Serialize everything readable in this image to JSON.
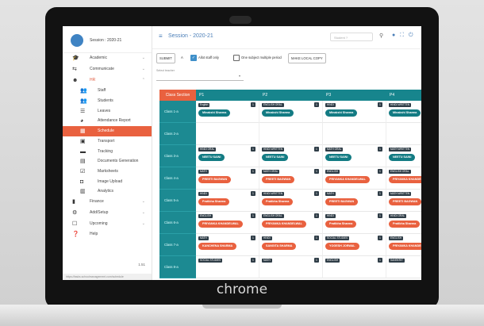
{
  "device": {
    "brand": "chrome"
  },
  "sidebar": {
    "session_label": "Session : 2020-21",
    "version": "1.51",
    "status_url": "https://tasks.schoolmanagement.com/schedule",
    "items": [
      {
        "label": "Academic",
        "icon": "graduation-cap-icon",
        "glyph": "🎓",
        "chevron": "⌄"
      },
      {
        "label": "Communicate",
        "icon": "chat-icon",
        "glyph": "⇆",
        "chevron": "⌄"
      },
      {
        "label": "HR",
        "icon": "hr-icon",
        "glyph": "☻",
        "chevron": "⌃"
      },
      {
        "label": "Staff",
        "icon": "staff-icon",
        "glyph": "👥",
        "sub": true
      },
      {
        "label": "Students",
        "icon": "students-icon",
        "glyph": "👥",
        "sub": true
      },
      {
        "label": "Leaves",
        "icon": "leaves-icon",
        "glyph": "☰",
        "sub": true
      },
      {
        "label": "Attendance Report",
        "icon": "attendance-icon",
        "glyph": "◕",
        "sub": true
      },
      {
        "label": "Schedule",
        "icon": "calendar-icon",
        "glyph": "▦",
        "sub": true,
        "active": true
      },
      {
        "label": "Transport",
        "icon": "bus-icon",
        "glyph": "▣",
        "sub": true
      },
      {
        "label": "Tracking",
        "icon": "truck-icon",
        "glyph": "▬",
        "sub": true
      },
      {
        "label": "Documents Generation",
        "icon": "document-icon",
        "glyph": "▤",
        "sub": true
      },
      {
        "label": "Marksheets",
        "icon": "marksheet-icon",
        "glyph": "☑",
        "sub": true
      },
      {
        "label": "Image Upload",
        "icon": "image-icon",
        "glyph": "◘",
        "sub": true
      },
      {
        "label": "Analytics",
        "icon": "analytics-icon",
        "glyph": "▥",
        "sub": true
      },
      {
        "label": "Finance",
        "icon": "finance-icon",
        "glyph": "▮",
        "chevron": "⌄"
      },
      {
        "label": "Add/Setup",
        "icon": "gear-icon",
        "glyph": "⚙",
        "chevron": "⌄"
      },
      {
        "label": "Upcoming",
        "icon": "upcoming-icon",
        "glyph": "☐",
        "chevron": "⌄"
      },
      {
        "label": "Help",
        "icon": "help-icon",
        "glyph": "❓"
      }
    ]
  },
  "topbar": {
    "menu_glyph": "≡",
    "title": "Session - 2020-21",
    "search_placeholder": "Student ?",
    "search_glyph": "⚲",
    "icons_glyph": "● ⛶ ⏻"
  },
  "toolbar": {
    "submit": "SUBMIT",
    "font_button": "A",
    "check_mark": "✓",
    "staff_only": "Allot staff only",
    "multiple_period": "One subject multiple period",
    "make_copy": "MAKE LOCAL COPY"
  },
  "filter": {
    "label": "Select teacher",
    "chevron": "▾"
  },
  "accent_colors": {
    "header": "#17858d",
    "active": "#e9613f",
    "teal_pill": "#137b83"
  },
  "schedule": {
    "corner": "Class Section",
    "periods": [
      "P1",
      "P2",
      "P3",
      "P4"
    ],
    "rows": [
      {
        "class": "Class 1-a",
        "cells": [
          {
            "subject": "English",
            "num": "1",
            "teacher": "Minakshi Sharma",
            "color": "teal"
          },
          {
            "subject": "ENGLISH ORAL",
            "num": "1",
            "teacher": "Minakshi Sharma",
            "color": "teal"
          },
          {
            "subject": "HINDI",
            "num": "1",
            "teacher": "Minakshi Sharma",
            "color": "teal"
          },
          {
            "subject": "HINDI WRITTEN",
            "num": "1",
            "teacher": "Minakshi Sharma",
            "color": "teal"
          }
        ]
      },
      {
        "class": "Class 2-a",
        "cells": [
          {},
          {},
          {},
          {}
        ]
      },
      {
        "class": "Class 3-a",
        "cells": [
          {
            "subject": "HINDI ORAL",
            "num": "1",
            "teacher": "NEETU SAINI",
            "color": "teal"
          },
          {
            "subject": "HINDI WRITTEN",
            "num": "1",
            "teacher": "NEETU SAINI",
            "color": "teal"
          },
          {
            "subject": "MATH ORAL",
            "num": "1",
            "teacher": "NEETU SAINI",
            "color": "teal"
          },
          {
            "subject": "MATH WRITTEN",
            "num": "1",
            "teacher": "NEETU SAINI",
            "color": "teal"
          }
        ]
      },
      {
        "class": "Class 4-a",
        "cells": [
          {
            "subject": "MATH",
            "num": "1",
            "teacher": "PREETI BAGWAN",
            "color": "orange"
          },
          {
            "subject": "MATH ORAL",
            "num": "1",
            "teacher": "PREETI BAGWAN",
            "color": "orange"
          },
          {
            "subject": "ENGLISH",
            "num": "1",
            "teacher": "PRIYANKA KHANDELWAL",
            "color": "orange"
          },
          {
            "subject": "ENGLISH ORAL",
            "num": "1",
            "teacher": "PRIYANKA KHANDELWAL",
            "color": "orange"
          }
        ]
      },
      {
        "class": "Class 5-a",
        "cells": [
          {
            "subject": "HINDI",
            "num": "1",
            "teacher": "Pratibha Sharma",
            "color": "orange"
          },
          {
            "subject": "HINDI WRITTEN",
            "num": "1",
            "teacher": "Pratibha Sharma",
            "color": "orange"
          },
          {
            "subject": "MATH",
            "num": "1",
            "teacher": "PREETI BAGWAN",
            "color": "orange"
          },
          {
            "subject": "MATH WRITTEN",
            "num": "1",
            "teacher": "PREETI BAGWAN",
            "color": "orange"
          }
        ]
      },
      {
        "class": "Class 6-a",
        "cells": [
          {
            "subject": "ENGLISH",
            "num": "1",
            "teacher": "PRIYANKA KHANDELWAL",
            "color": "orange"
          },
          {
            "subject": "ENGLISH ORAL",
            "num": "1",
            "teacher": "PRIYANKA KHANDELWAL",
            "color": "orange"
          },
          {
            "subject": "HINDI",
            "num": "1",
            "teacher": "Pratibha Sharma",
            "color": "orange"
          },
          {
            "subject": "HINDI ORAL",
            "num": "1",
            "teacher": "Pratibha Sharma",
            "color": "orange"
          }
        ]
      },
      {
        "class": "Class 7-a",
        "cells": [
          {
            "subject": "MATH",
            "num": "1",
            "teacher": "KANCHENA SHARMA",
            "color": "orange"
          },
          {
            "subject": "HINDI",
            "num": "1",
            "teacher": "SANGITA SHARMA",
            "color": "orange"
          },
          {
            "subject": "SOCIAL STUDIES",
            "num": "1",
            "teacher": "YOGESH JORWAL",
            "color": "orange"
          },
          {
            "subject": "ENGLISH",
            "num": "1",
            "teacher": "PRIYANKA KHANDELWAL",
            "color": "orange"
          }
        ]
      },
      {
        "class": "Class 8-a",
        "cells": [
          {
            "subject": "SOCIAL STUDIES",
            "num": "1"
          },
          {
            "subject": "MATH",
            "num": "1"
          },
          {
            "subject": "ENGLISH",
            "num": "1"
          },
          {
            "subject": "SANSKRIT",
            "num": "1"
          }
        ]
      }
    ]
  }
}
